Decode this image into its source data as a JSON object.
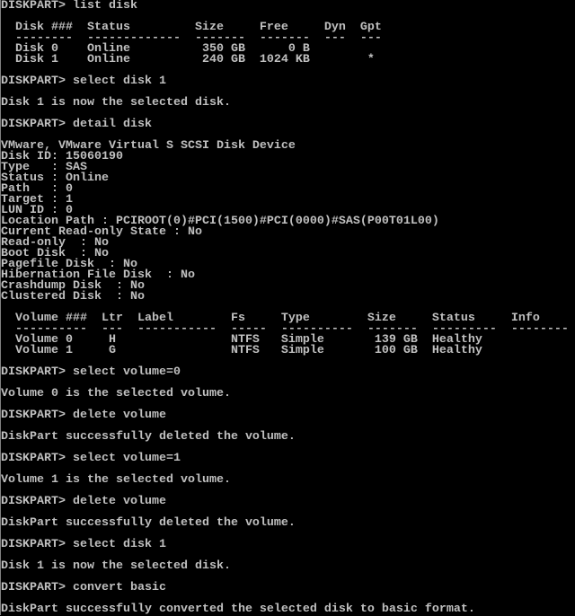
{
  "console": {
    "colors": {
      "background": "#000000",
      "text": "#c0c0c0"
    },
    "lines": [
      "DISKPART> list disk",
      "",
      "  Disk ###  Status         Size     Free     Dyn  Gpt",
      "  --------  -------------  -------  -------  ---  ---",
      "  Disk 0    Online          350 GB      0 B",
      "  Disk 1    Online          240 GB  1024 KB        *",
      "",
      "DISKPART> select disk 1",
      "",
      "Disk 1 is now the selected disk.",
      "",
      "DISKPART> detail disk",
      "",
      "VMware, VMware Virtual S SCSI Disk Device",
      "Disk ID: 15060190",
      "Type   : SAS",
      "Status : Online",
      "Path   : 0",
      "Target : 1",
      "LUN ID : 0",
      "Location Path : PCIROOT(0)#PCI(1500)#PCI(0000)#SAS(P00T01L00)",
      "Current Read-only State : No",
      "Read-only  : No",
      "Boot Disk  : No",
      "Pagefile Disk  : No",
      "Hibernation File Disk  : No",
      "Crashdump Disk  : No",
      "Clustered Disk  : No",
      "",
      "  Volume ###  Ltr  Label        Fs     Type        Size     Status     Info",
      "  ----------  ---  -----------  -----  ----------  -------  ---------  --------",
      "  Volume 0     H                NTFS   Simple       139 GB  Healthy",
      "  Volume 1     G                NTFS   Simple       100 GB  Healthy",
      "",
      "DISKPART> select volume=0",
      "",
      "Volume 0 is the selected volume.",
      "",
      "DISKPART> delete volume",
      "",
      "DiskPart successfully deleted the volume.",
      "",
      "DISKPART> select volume=1",
      "",
      "Volume 1 is the selected volume.",
      "",
      "DISKPART> delete volume",
      "",
      "DiskPart successfully deleted the volume.",
      "",
      "DISKPART> select disk 1",
      "",
      "Disk 1 is now the selected disk.",
      "",
      "DISKPART> convert basic",
      "",
      "DiskPart successfully converted the selected disk to basic format."
    ]
  }
}
